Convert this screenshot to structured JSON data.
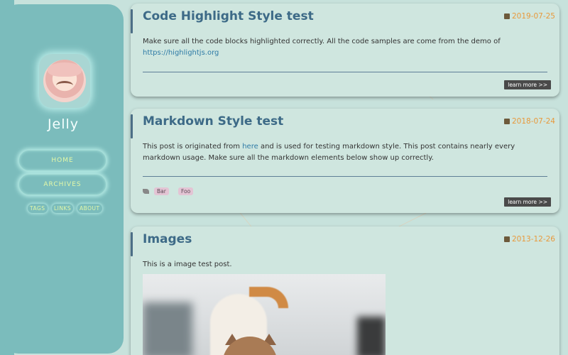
{
  "sidebar": {
    "site_title": "Jelly",
    "nav": {
      "home": "HOME",
      "archives": "ARCHIVES",
      "tags": "TAGS",
      "links": "LINKS",
      "about": "ABOUT"
    }
  },
  "posts": [
    {
      "title": "Code Highlight Style test",
      "date": "2019-07-25",
      "excerpt_1": "Make sure all the code blocks highlighted correctly. All the code samples are come from the demo of",
      "link_text": "https://highlightjs.org",
      "learn_more": "learn more >>"
    },
    {
      "title": "Markdown Style test",
      "date": "2018-07-24",
      "excerpt_pre": "This post is originated from ",
      "link_text": "here",
      "excerpt_post": " and is used for testing markdown style. This post contains nearly every markdown usage. Make sure all the markdown elements below show up correctly.",
      "tags": [
        "Bar",
        "Foo"
      ],
      "learn_more": "learn more >>"
    },
    {
      "title": "Images",
      "date": "2013-12-26",
      "excerpt": "This is a image test post."
    }
  ],
  "colors": {
    "background": "#c7e2dc",
    "sidebar": "#7bbcbc",
    "card": "#cfe6df",
    "title": "#3d6a87",
    "date": "#e8993b",
    "link": "#2f7ba6",
    "nav_text": "#e4f9a8"
  },
  "icons": {
    "date": "calendar-icon",
    "tags": "tag-icon"
  }
}
